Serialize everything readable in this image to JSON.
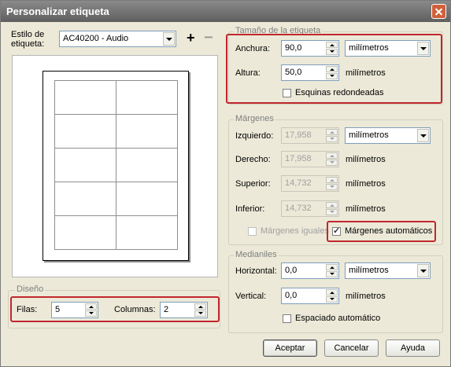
{
  "window": {
    "title": "Personalizar etiqueta"
  },
  "style": {
    "label_line1": "Estilo de",
    "label_line2": "etiqueta:",
    "selected": "AC40200 - Audio"
  },
  "size_group": {
    "title": "Tamaño de la etiqueta",
    "width_label": "Anchura:",
    "width_value": "90,0",
    "width_unit": "milímetros",
    "height_label": "Altura:",
    "height_value": "50,0",
    "height_unit": "milímetros",
    "rounded_label": "Esquinas redondeadas",
    "rounded_checked": false
  },
  "margins_group": {
    "title": "Márgenes",
    "left_label": "Izquierdo:",
    "left_value": "17,958",
    "left_unit": "milímetros",
    "right_label": "Derecho:",
    "right_value": "17,958",
    "right_unit": "milímetros",
    "top_label": "Superior:",
    "top_value": "14,732",
    "top_unit": "milímetros",
    "bottom_label": "Inferior:",
    "bottom_value": "14,732",
    "bottom_unit": "milímetros",
    "equal_label": "Márgenes iguales",
    "equal_checked": false,
    "auto_label": "Márgenes automáticos",
    "auto_checked": true
  },
  "gutters_group": {
    "title": "Medianiles",
    "horizontal_label": "Horizontal:",
    "horizontal_value": "0,0",
    "horizontal_unit": "milímetros",
    "vertical_label": "Vertical:",
    "vertical_value": "0,0",
    "vertical_unit": "milímetros",
    "auto_spacing_label": "Espaciado automático",
    "auto_spacing_checked": false
  },
  "layout_group": {
    "title": "Diseño",
    "rows_label": "Filas:",
    "rows_value": "5",
    "cols_label": "Columnas:",
    "cols_value": "2"
  },
  "buttons": {
    "accept": "Aceptar",
    "cancel": "Cancelar",
    "help": "Ayuda"
  },
  "icons": {
    "add": "+",
    "remove": "−"
  },
  "colors": {
    "highlight": "#c1272d",
    "titlebar": "#6f6f6f",
    "dialog_bg": "#ece9d8"
  }
}
